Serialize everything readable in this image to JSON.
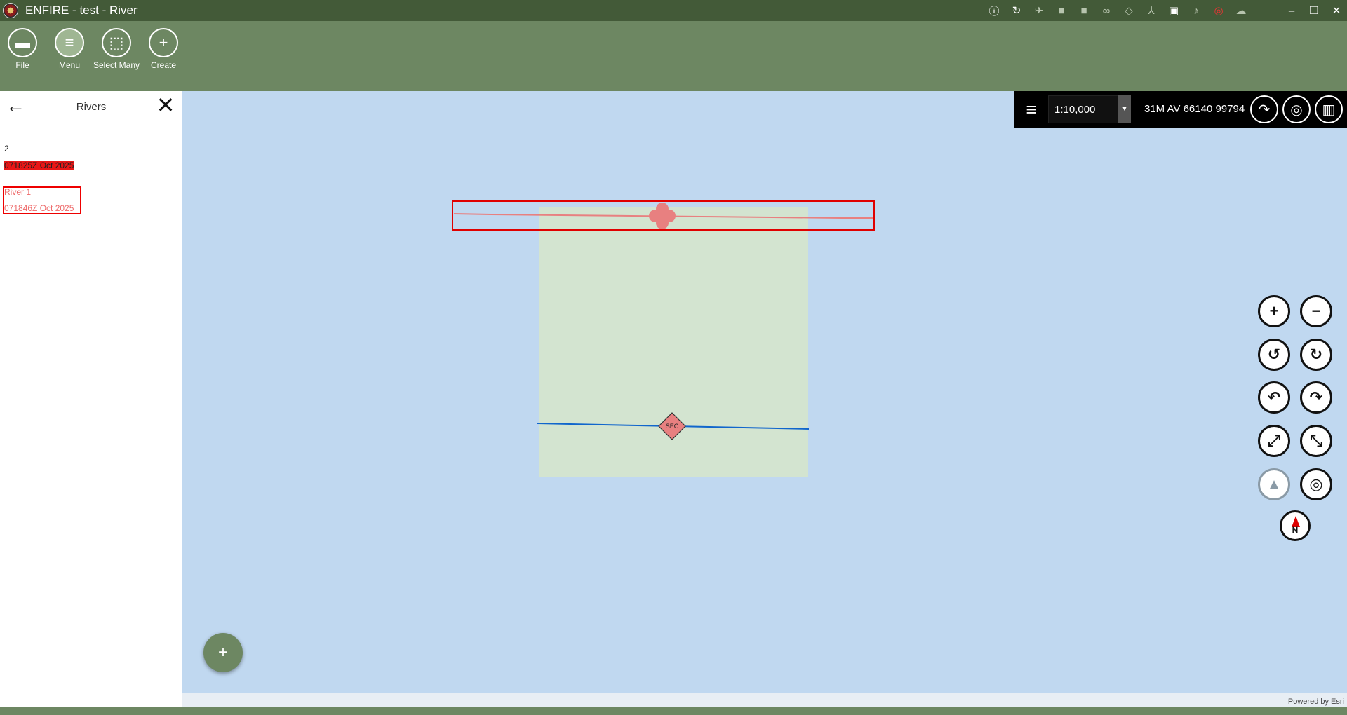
{
  "window": {
    "title": "ENFIRE - test - River",
    "status_icons": [
      "info-icon",
      "refresh-icon",
      "satellite-icon",
      "video-icon",
      "camera-icon",
      "binoculars-icon",
      "cube-icon",
      "axis-icon",
      "camcorder-icon",
      "microphone-icon",
      "sync-icon",
      "cloud-icon"
    ],
    "controls": [
      "minimize",
      "restore",
      "close"
    ]
  },
  "toolbar": {
    "items": [
      {
        "label": "File",
        "icon": "folder-icon"
      },
      {
        "label": "Menu",
        "icon": "menu-icon"
      },
      {
        "label": "Select Many",
        "icon": "select-many-icon"
      },
      {
        "label": "Create",
        "icon": "plus-icon"
      }
    ]
  },
  "panel": {
    "title": "Rivers",
    "items": [
      {
        "name": "2",
        "date": "071825Z Oct 2025"
      },
      {
        "name": "River 1",
        "date": "071846Z Oct 2025"
      }
    ]
  },
  "map": {
    "scale": "1:10,000",
    "coordinate": "31M AV 66140 99794",
    "attribution": "Powered by Esri",
    "symbol_label": "SEC",
    "colors": {
      "water": "#c0d8f0",
      "zone": "#d3e4d0",
      "river_selected": "#e88080",
      "river": "#1166cc",
      "selection": "#e00000"
    }
  }
}
